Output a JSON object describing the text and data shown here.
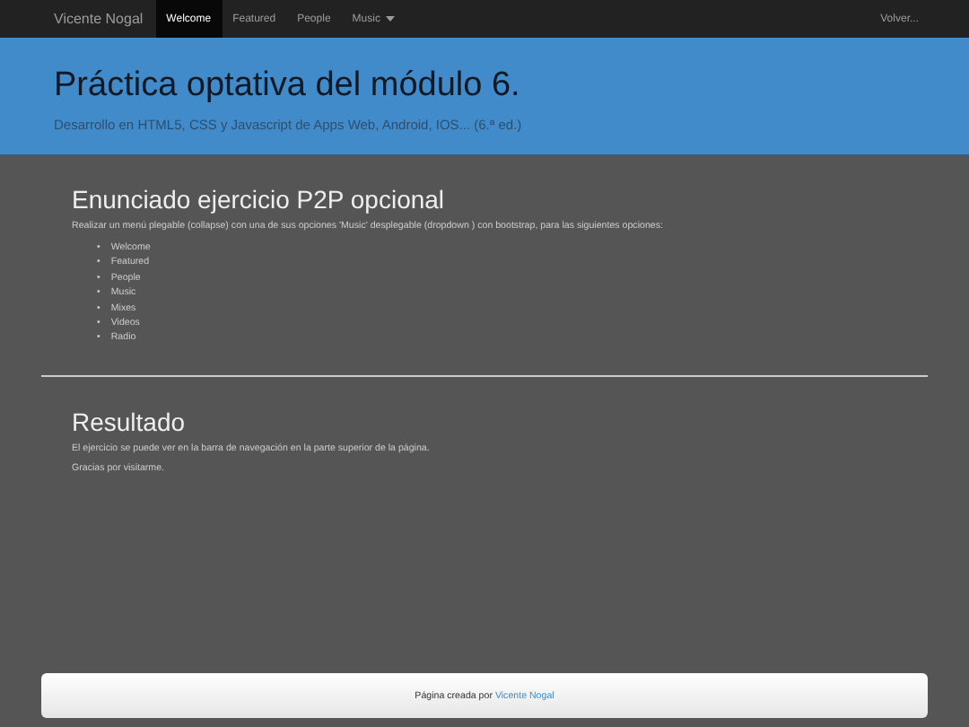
{
  "navbar": {
    "brand": "Vicente Nogal",
    "items": [
      {
        "label": "Welcome",
        "selected": true,
        "dropdown": false
      },
      {
        "label": "Featured",
        "selected": false,
        "dropdown": false
      },
      {
        "label": "People",
        "selected": false,
        "dropdown": false
      },
      {
        "label": "Music",
        "selected": false,
        "dropdown": true
      }
    ],
    "right_link": "Volver..."
  },
  "header": {
    "title": "Práctica optativa del módulo 6.",
    "subtitle": "Desarrollo en HTML5, CSS y Javascript de Apps Web, Android, IOS... (6.ª ed.)"
  },
  "statement": {
    "heading": "Enunciado ejercicio P2P opcional",
    "text": "Realizar un menú plegable (collapse) con una de sus opciones 'Music' desplegable (dropdown ) con bootstrap, para las siguientes opciones:",
    "options": [
      {
        "bullet": "•",
        "label": "Welcome"
      },
      {
        "bullet": "•",
        "label": "Featured"
      },
      {
        "bullet": "•",
        "label": "People"
      },
      {
        "bullet": "•",
        "label": "Music"
      },
      {
        "bullet": "•",
        "label": "Mixes"
      },
      {
        "bullet": "•",
        "label": "Videos"
      },
      {
        "bullet": "•",
        "label": "Radio"
      }
    ]
  },
  "result": {
    "heading": "Resultado",
    "paragraphs": [
      "El ejercicio se puede ver en la barra de navegación en la parte superior de la página.",
      "Gracias por visitarme."
    ]
  },
  "footer": {
    "text": "Página creada por",
    "link": "Vicente Nogal"
  }
}
